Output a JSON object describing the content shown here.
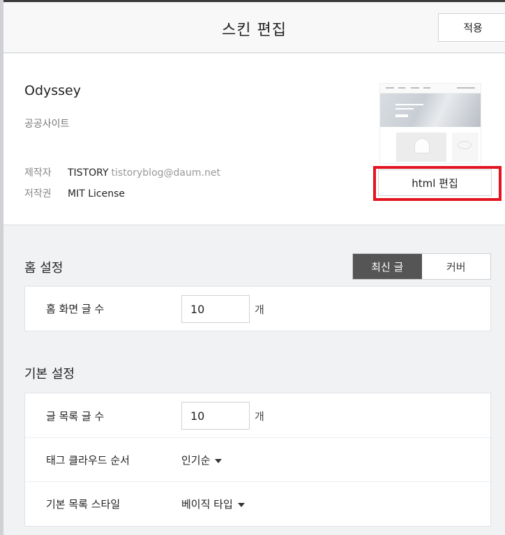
{
  "header": {
    "title": "스킨 편집",
    "apply_label": "적용"
  },
  "skin": {
    "name": "Odyssey",
    "category": "공공사이트",
    "maker_key": "제작자",
    "maker_name": "TISTORY",
    "maker_email": "tistoryblog@daum.net",
    "license_key": "저작권",
    "license_value": "MIT License",
    "html_edit_label": "html 편집"
  },
  "home_settings": {
    "title": "홈 설정",
    "tabs": [
      "최신 글",
      "커버"
    ],
    "active_tab": "최신 글",
    "post_count_label": "홈 화면 글 수",
    "post_count_value": "10",
    "unit": "개"
  },
  "basic_settings": {
    "title": "기본 설정",
    "list_count_label": "글 목록 글 수",
    "list_count_value": "10",
    "unit": "개",
    "tag_cloud_label": "태그 클라우드 순서",
    "tag_cloud_value": "인기순",
    "list_style_label": "기본 목록 스타일",
    "list_style_value": "베이직 타입"
  },
  "colors": {
    "highlight": "#e3141f",
    "active_tab_bg": "#555555"
  }
}
